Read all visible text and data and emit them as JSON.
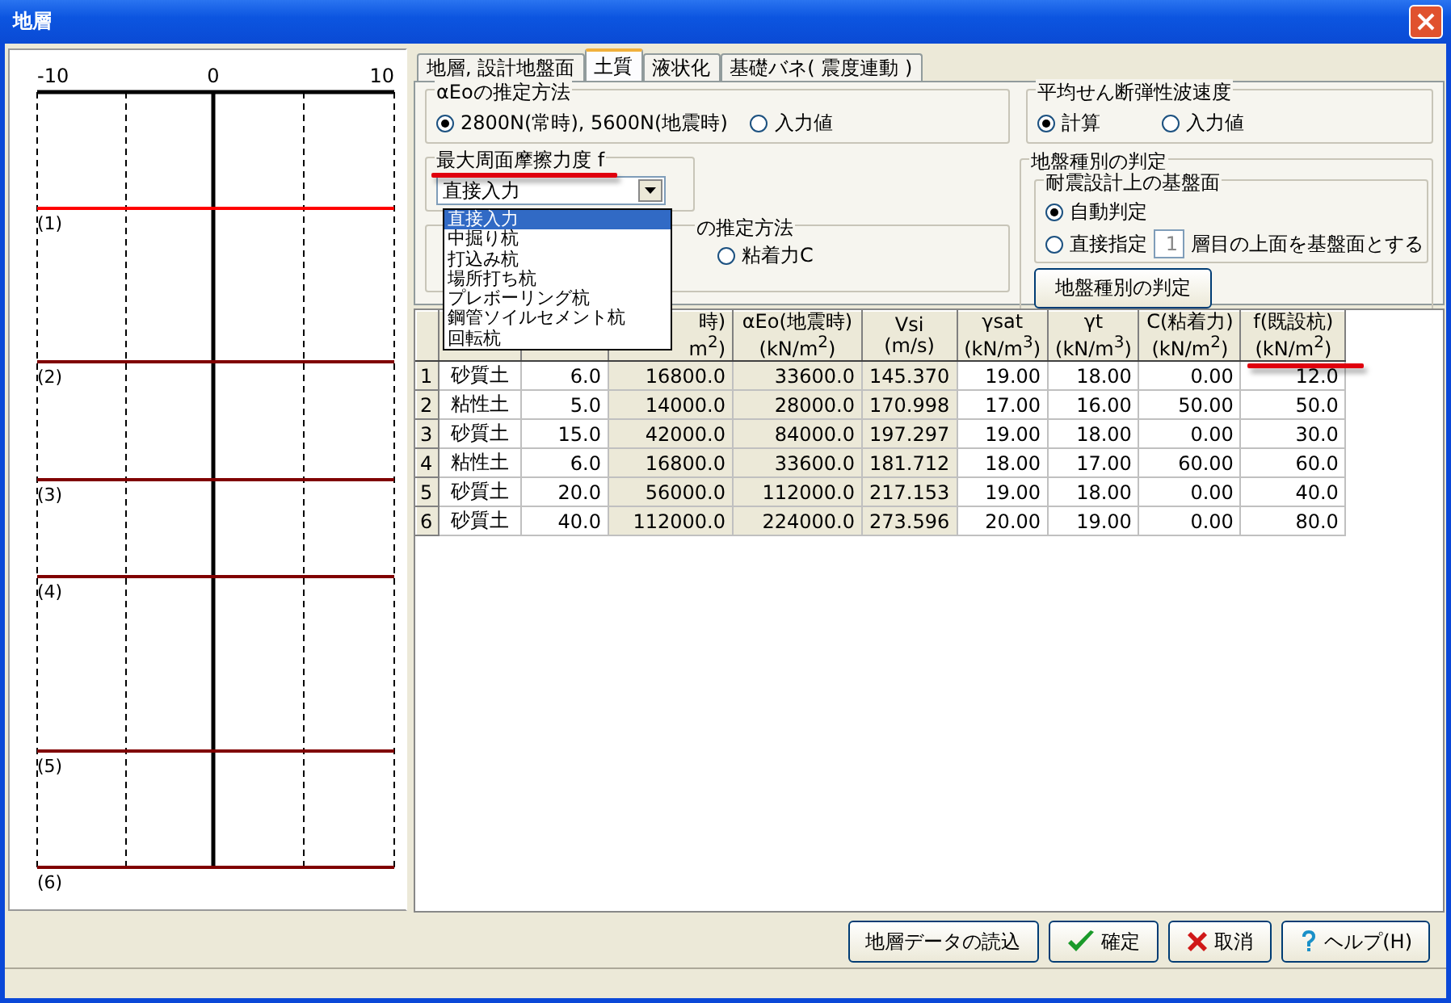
{
  "window": {
    "title": "地層"
  },
  "diagram": {
    "axis_labels": [
      "-10",
      "0",
      "10"
    ],
    "layers": [
      {
        "label": "(1)",
        "selected": true
      },
      {
        "label": "(2)",
        "selected": false
      },
      {
        "label": "(3)",
        "selected": false
      },
      {
        "label": "(4)",
        "selected": false
      },
      {
        "label": "(5)",
        "selected": false
      },
      {
        "label": "(6)",
        "selected": false
      }
    ]
  },
  "tabs": [
    {
      "label": "地層, 設計地盤面",
      "selected": false
    },
    {
      "label": "土質",
      "selected": true
    },
    {
      "label": "液状化",
      "selected": false
    },
    {
      "label": "基礎バネ( 震度連動 )",
      "selected": false
    }
  ],
  "eo_method": {
    "title": "αEoの推定方法",
    "options": [
      {
        "label": "2800N(常時), 5600N(地震時)",
        "selected": true
      },
      {
        "label": "入力値",
        "selected": false
      }
    ]
  },
  "max_friction": {
    "title": "最大周面摩擦力度 f",
    "value": "直接入力",
    "options": [
      {
        "label": "直接入力",
        "selected": true
      },
      {
        "label": "中掘り杭",
        "selected": false
      },
      {
        "label": "打込み杭",
        "selected": false
      },
      {
        "label": "場所打ち杭",
        "selected": false
      },
      {
        "label": "プレボーリング杭",
        "selected": false
      },
      {
        "label": "鋼管ソイルセメント杭",
        "selected": false
      },
      {
        "label": "回転杭",
        "selected": false
      }
    ]
  },
  "partial_group": {
    "title": "の推定方法",
    "options": [
      {
        "label": "粘着力C",
        "selected": false
      }
    ]
  },
  "vs_method": {
    "title": "平均せん断弾性波速度",
    "options": [
      {
        "label": "計算",
        "selected": true
      },
      {
        "label": "入力値",
        "selected": false
      }
    ]
  },
  "ground_type": {
    "title": "地盤種別の判定",
    "base": {
      "title": "耐震設計上の基盤面",
      "options": [
        {
          "label": "自動判定",
          "selected": true
        },
        {
          "label": "直接指定",
          "selected": false
        }
      ],
      "layer_value": "1",
      "layer_suffix": "層目の上面を基盤面とする"
    },
    "button": "地盤種別の判定"
  },
  "table": {
    "columns": [
      {
        "shaded": false
      },
      {
        "shaded": false
      },
      {
        "header": [
          "時)",
          "m$^{2}$)"
        ],
        "shaded": true
      },
      {
        "header": [
          "αEo(地震時)",
          "(kN/m$^{2}$)"
        ],
        "shaded": true
      },
      {
        "header": [
          "Vsi",
          "(m/s)"
        ],
        "shaded": true
      },
      {
        "header": [
          "γsat",
          "(kN/m$^{3}$)"
        ],
        "shaded": false
      },
      {
        "header": [
          "γt",
          "(kN/m$^{3}$)"
        ],
        "shaded": false
      },
      {
        "header": [
          "C(粘着力)",
          "(kN/m$^{2}$)"
        ],
        "shaded": false
      },
      {
        "header": [
          "f(既設杭)",
          "(kN/m$^{2}$)"
        ],
        "shaded": false
      }
    ],
    "rows": [
      {
        "num": "1",
        "cells": [
          "砂質土",
          "6.0",
          "16800.0",
          "33600.0",
          "145.370",
          "19.00",
          "18.00",
          "0.00",
          "12.0"
        ]
      },
      {
        "num": "2",
        "cells": [
          "粘性土",
          "5.0",
          "14000.0",
          "28000.0",
          "170.998",
          "17.00",
          "16.00",
          "50.00",
          "50.0"
        ]
      },
      {
        "num": "3",
        "cells": [
          "砂質土",
          "15.0",
          "42000.0",
          "84000.0",
          "197.297",
          "19.00",
          "18.00",
          "0.00",
          "30.0"
        ]
      },
      {
        "num": "4",
        "cells": [
          "粘性土",
          "6.0",
          "16800.0",
          "33600.0",
          "181.712",
          "18.00",
          "17.00",
          "60.00",
          "60.0"
        ]
      },
      {
        "num": "5",
        "cells": [
          "砂質土",
          "20.0",
          "56000.0",
          "112000.0",
          "217.153",
          "19.00",
          "18.00",
          "0.00",
          "40.0"
        ]
      },
      {
        "num": "6",
        "cells": [
          "砂質土",
          "40.0",
          "112000.0",
          "224000.0",
          "273.596",
          "20.00",
          "19.00",
          "0.00",
          "80.0"
        ]
      }
    ]
  },
  "buttons": [
    {
      "label": "地層データの読込",
      "kind": "plain"
    },
    {
      "label": "確定",
      "kind": "ok"
    },
    {
      "label": "取消",
      "kind": "cancel"
    },
    {
      "label": "ヘルプ(H)",
      "kind": "help"
    }
  ]
}
